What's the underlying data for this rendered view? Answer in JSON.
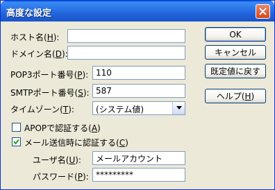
{
  "window": {
    "title": "高度な設定"
  },
  "fields": {
    "host": {
      "label": "ホスト名",
      "key": "H",
      "value": ""
    },
    "domain": {
      "label": "ドメイン名",
      "key": "D",
      "value": ""
    },
    "pop3_port": {
      "label": "POP3ポート番号",
      "key": "P",
      "value": "110"
    },
    "smtp_port": {
      "label": "SMTPポート番号",
      "key": "S",
      "value": "587"
    },
    "timezone": {
      "label": "タイムゾーン",
      "key": "T",
      "value": "(システム値)"
    },
    "username": {
      "label": "ユーザ名",
      "key": "U",
      "value": "メールアカウント"
    },
    "password": {
      "label": "パスワード",
      "key": "P",
      "value": "*********"
    }
  },
  "checks": {
    "apop": {
      "label": "APOPで認証する",
      "key": "A",
      "checked": false
    },
    "smtp_auth": {
      "label": "メール送信時に認証する",
      "key": "C",
      "checked": true
    }
  },
  "buttons": {
    "ok": "OK",
    "cancel": "キャンセル",
    "reset": "既定値に戻す",
    "help_label": "ヘルプ",
    "help_key": "H"
  },
  "icons": {
    "close": "close-icon",
    "dropdown": "chevron-down-icon",
    "check": "checkmark-icon"
  },
  "colors": {
    "titlebar": "#2b74e7",
    "dialog_bg": "#ece9d8",
    "close_button": "#d6461c"
  }
}
